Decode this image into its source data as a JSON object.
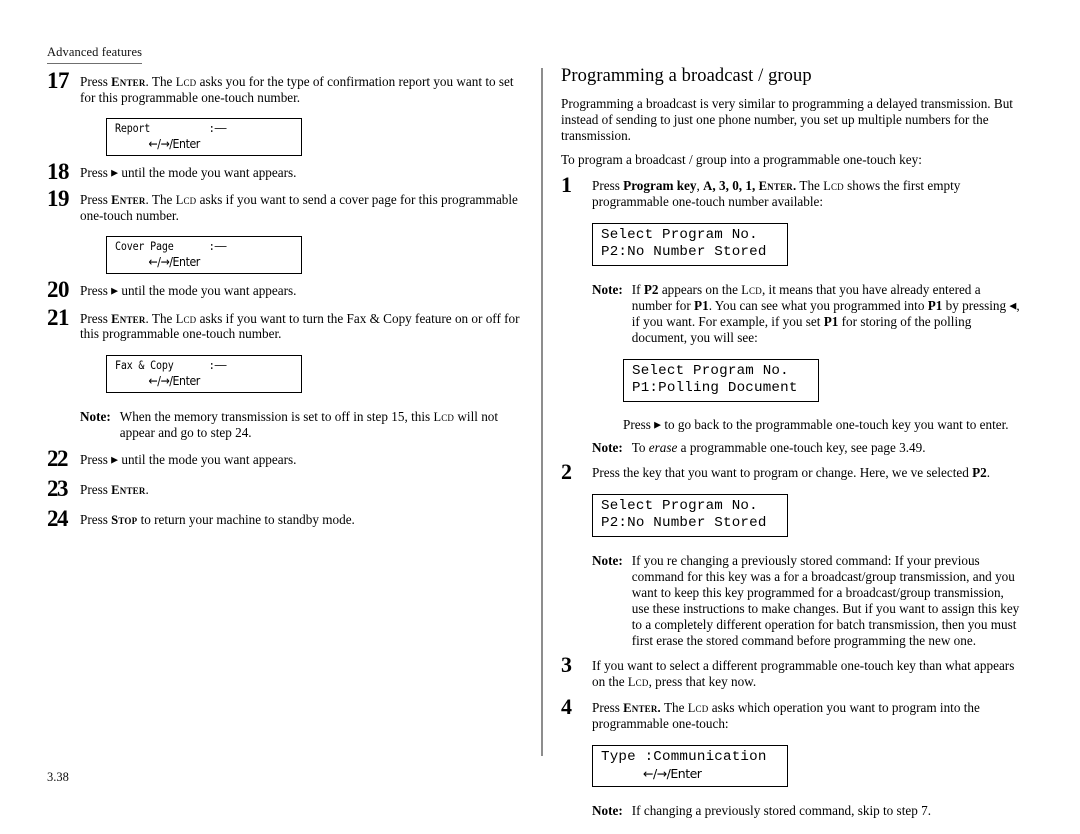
{
  "page": {
    "running_header": "Advanced features",
    "folio": "3.38"
  },
  "left_column": {
    "steps": [
      {
        "number": "17",
        "text_html": "Press <span class=\"scb\">Enter</span>. The <span class=\"sc\">LCD</span> asks you for the type of confirmation report you want to set for this programmable one-touch number.",
        "text_plain": "Press ENTER. The LCD asks you for the type of confirmation report you want to set for this programmable one-touch number."
      },
      {
        "number": "18",
        "text_plain": "Press ► until the mode you want appears."
      },
      {
        "number": "19",
        "text_plain": "Press ENTER. The LCD asks if you want to send a cover page for this programmable one-touch number."
      },
      {
        "number": "20",
        "text_plain": "Press ► until the mode you want appears."
      },
      {
        "number": "21",
        "text_plain": "Press ENTER. The LCD asks if you want to turn the Fax & Copy feature on or off for this programmable one-touch number."
      },
      {
        "number": "22",
        "text_plain": "Press ► until the mode you want appears."
      },
      {
        "number": "23",
        "text_plain": "Press ENTER."
      },
      {
        "number": "24",
        "text_plain": "Press STOP to return your machine to standby mode."
      }
    ],
    "lcd_report": {
      "line1": "Report          :——",
      "line2": "←/→/Enter"
    },
    "lcd_cover_page": {
      "line1": "Cover Page      :——",
      "line2": "←/→/Enter"
    },
    "lcd_fax_copy": {
      "line1": "Fax & Copy      :——",
      "line2": "←/→/Enter"
    },
    "note_memory": {
      "label": "Note:",
      "text": "When the memory transmission is set to off in step 15, this LCD will not appear and go to step 24."
    }
  },
  "right_column": {
    "section_title": "Programming a broadcast / group",
    "intro_paragraph": "Programming a broadcast is very similar to programming a delayed transmission. But instead of sending to just one phone number, you set up multiple numbers for the transmission.",
    "lead_in": "To program a broadcast / group into a programmable one-touch key:",
    "steps": [
      {
        "number": "1",
        "text_plain": "Press Program key, A, 3, 0, 1, ENTER. The LCD shows the first empty programmable one-touch number available:"
      },
      {
        "number": "2",
        "text_plain": "Press the key that you want to program or change. Here, we ve selected P2."
      },
      {
        "number": "3",
        "text_plain": "If you want to select a different programmable one-touch key than what appears on the LCD, press that key now."
      },
      {
        "number": "4",
        "text_plain": "Press ENTER. The LCD asks which operation you want to program into the programmable one-touch:"
      }
    ],
    "lcd_select_p2_first": {
      "line1": "Select Program No.",
      "line2": "P2:No Number Stored"
    },
    "lcd_select_p1_polling": {
      "line1": "Select Program No.",
      "line2": "P1:Polling Document"
    },
    "lcd_select_p2_second": {
      "line1": "Select Program No.",
      "line2": "P2:No Number Stored"
    },
    "lcd_type_communication": {
      "line1": "Type :Communication",
      "line2": "←/→/Enter"
    },
    "note_p2": {
      "label": "Note:",
      "text": "If P2 appears on the LCD, it means that you have already entered a number for P1. You can see what you programmed into P1 by pressing ◄, if you want. For example, if you set P1 for storing of the polling document, you will see:"
    },
    "note_p2_followup": "Press ► to go back to the programmable one-touch key you want to enter.",
    "note_erase": {
      "label": "Note:",
      "text": "To erase a programmable one-touch key, see page 3.49."
    },
    "note_changing": {
      "label": "Note:",
      "text": "If you re changing a previously stored command: If your previous command for this key was a for a broadcast/group transmission, and you want to keep this key programmed for a broadcast/group transmission, use these instructions to make changes. But if you want to assign this key to a completely different operation for batch transmission, then you must first erase the stored command before programming the new one."
    },
    "note_skip": {
      "label": "Note:",
      "text": "If changing a previously stored command, skip to step 7."
    }
  }
}
